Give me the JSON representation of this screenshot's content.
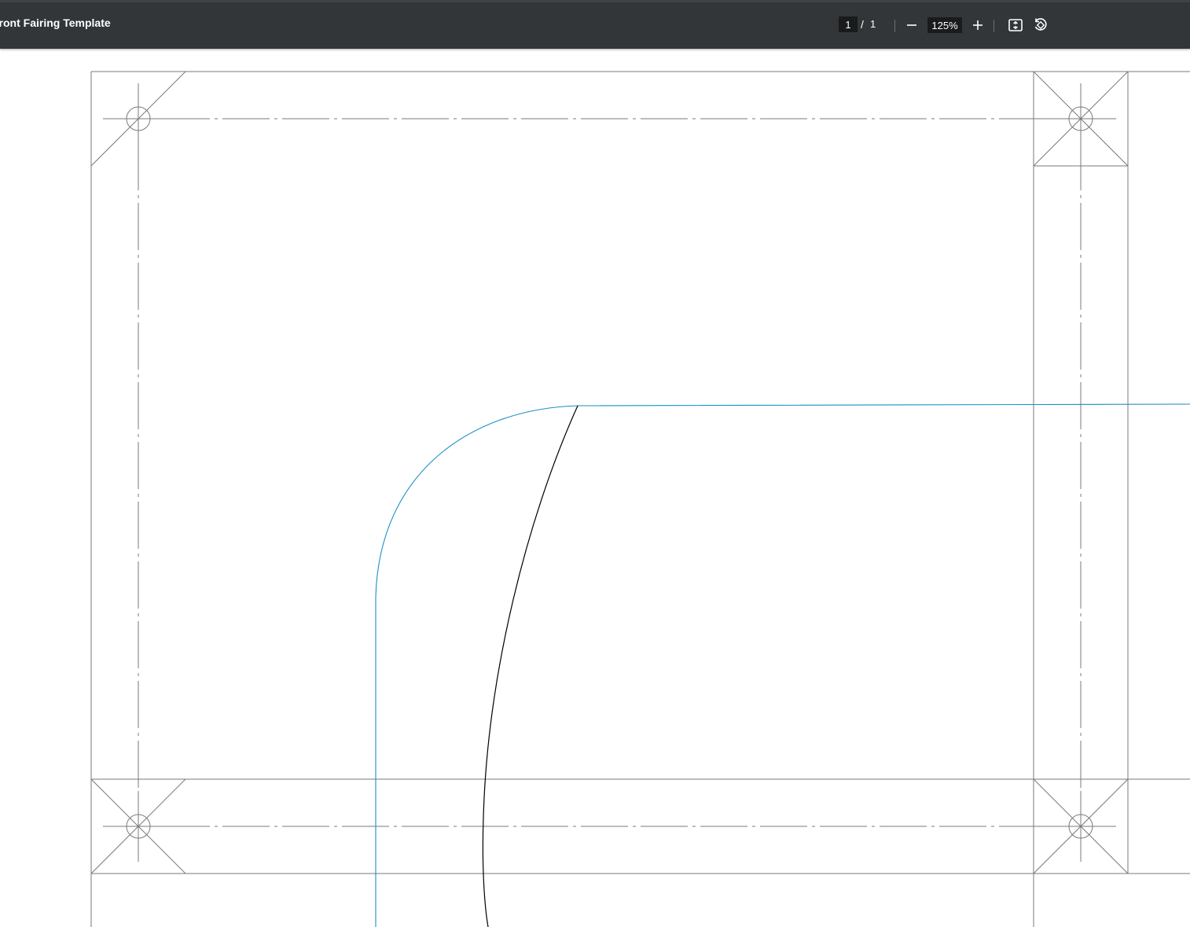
{
  "toolbar": {
    "title": "Front Fairing Template",
    "page_current": "1",
    "page_separator": "/",
    "page_total": "1",
    "zoom": "125%"
  },
  "icons": {
    "zoom_out": "minus-icon",
    "zoom_in": "plus-icon",
    "fit": "fit-to-page-icon",
    "rotate": "rotate-icon"
  },
  "colors": {
    "toolbar_bg": "#323639",
    "frame_line": "#777777",
    "outline_blue": "#1a8fc7",
    "cut_line": "#000000"
  }
}
